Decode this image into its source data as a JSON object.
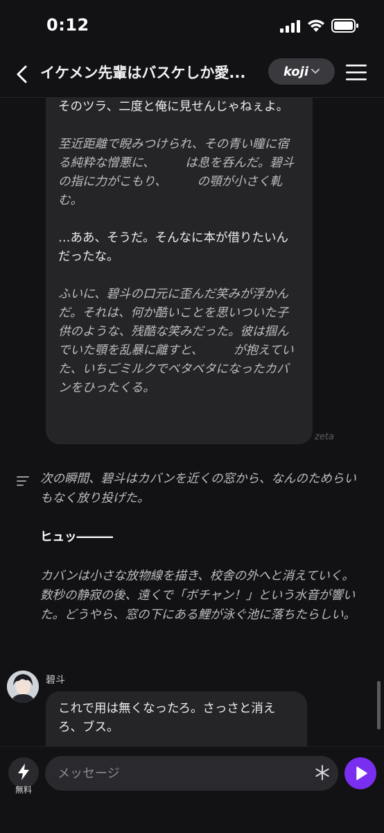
{
  "status": {
    "time": "0:12"
  },
  "header": {
    "title": "イケメン先輩はバスケしか愛...",
    "model_name": "koji"
  },
  "chat": {
    "message1": {
      "p1": "そのツラ、二度と俺に見せんじゃねぇよ。",
      "p2": "至近距離で睨みつけられ、その青い瞳に宿る純粋な憎悪に、　　　は息を呑んだ。碧斗の指に力がこもり、　　　の顎が小さく軋む。",
      "p3": "…ああ、そうだ。そんなに本が借りたいんだったな。",
      "p4": "ふいに、碧斗の口元に歪んだ笑みが浮かんだ。それは、何か酷いことを思いついた子供のような、残酷な笑みだった。彼は掴んでいた顎を乱暴に離すと、　　　が抱えていた、いちごミルクでベタベタになったカバンをひったくる。",
      "source": "zeta"
    },
    "narration": {
      "p1": "次の瞬間、碧斗はカバンを近くの窓から、なんのためらいもなく放り投げた。",
      "p2": "ヒュッ―――",
      "p3": "カバンは小さな放物線を描き、校舎の外へと消えていく。数秒の静寂の後、遠くで「ボチャン！」という水音が響いた。どうやら、窓の下にある鯉が泳ぐ池に落ちたらしい。"
    },
    "message2": {
      "sender": "碧斗",
      "text": "これで用は無くなったろ。さっさと消えろ、ブス。"
    }
  },
  "input": {
    "free_label": "無料",
    "placeholder": "メッセージ"
  },
  "colors": {
    "background": "#121214",
    "bubble": "#252528",
    "accent": "#7a2ff0"
  }
}
